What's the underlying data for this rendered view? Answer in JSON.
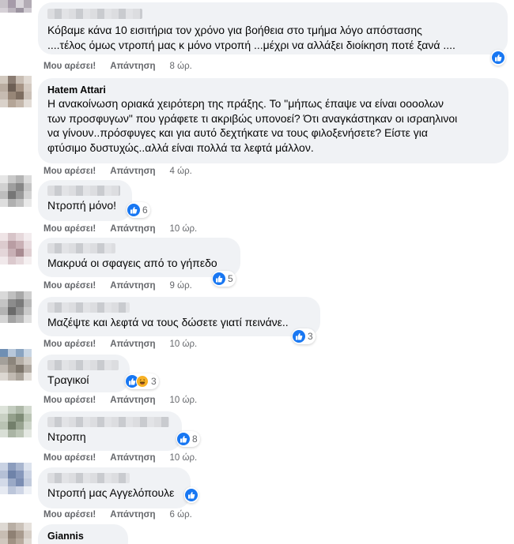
{
  "actions": {
    "like": "Μου αρέσει!",
    "reply": "Απάντηση"
  },
  "comments": [
    {
      "author": "",
      "text": "Κόβαμε κάνα 10 εισιτήρια τον χρόνο για βοήθεια στο τμήμα λόγο απόστασης\n....τέλος όμως ντροπή μας κ μόνο ντροπή ...μέχρι να αλλάξει διοίκηση ποτέ ξανά ....",
      "time": "8 ώρ.",
      "reactions": ""
    },
    {
      "author": "Hatem Attari",
      "text": "Η ανακοίνωση οριακά χειρότερη της πράξης. Το \"μήπως έπαψε να είναι οοοολων\nτων προσφυγων\" που γράφετε τι ακριβώς υπονοεί? Ότι αναγκάστηκαν οι ισραηλινοι\nνα γίνουν..πρόσφυγες και για αυτό δεχτήκατε να τους φιλοξενήσετε? Είστε για\nφτύσιμο δυστυχώς..αλλά είναι πολλά τα λεφτά μάλλον.",
      "time": "4 ώρ.",
      "reactions": ""
    },
    {
      "author": "",
      "text": "Ντροπή μόνο!",
      "time": "10 ώρ.",
      "reactions": "6"
    },
    {
      "author": "",
      "text": "Μακρυά οι σφαγεις από το γήπεδο",
      "time": "9 ώρ.",
      "reactions": "5"
    },
    {
      "author": "",
      "text": "Μαζέψτε και λεφτά να τους δώσετε γιατί πεινάνε..",
      "time": "10 ώρ.",
      "reactions": "3"
    },
    {
      "author": "",
      "text": "Τραγικοί",
      "time": "10 ώρ.",
      "reactions": "3"
    },
    {
      "author": "",
      "text": "Ντροπη",
      "time": "10 ώρ.",
      "reactions": "8"
    },
    {
      "author": "",
      "text": "Ντροπή μας Αγγελόπουλε",
      "time": "6 ώρ.",
      "reactions": ""
    },
    {
      "author": "Giannis KampPo",
      "text": "",
      "time": "",
      "reactions": ""
    }
  ]
}
